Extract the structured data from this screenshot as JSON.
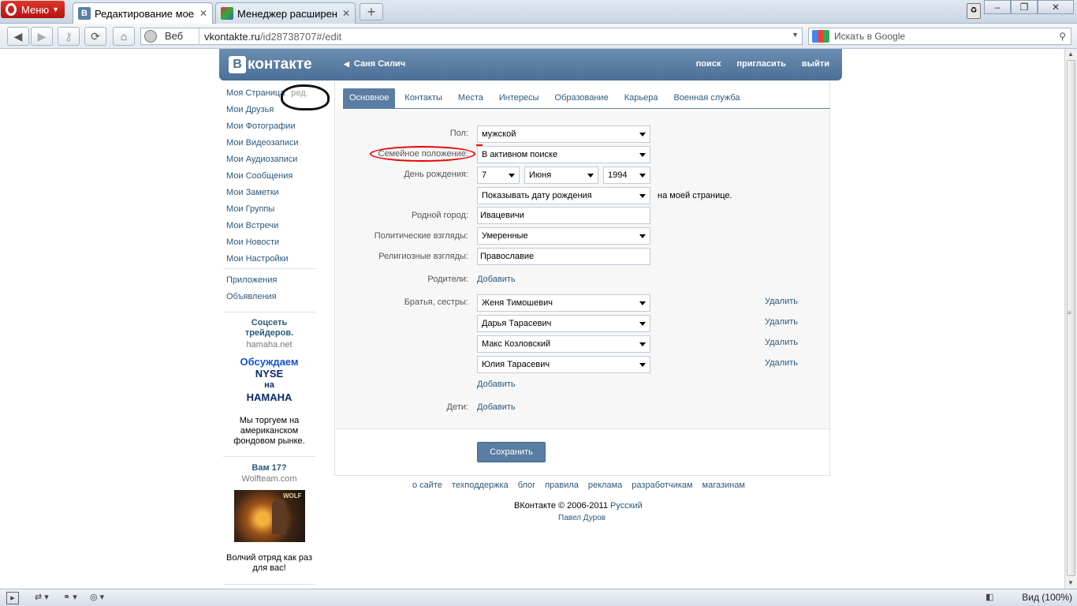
{
  "browser": {
    "menu_label": "Меню",
    "tabs": [
      {
        "title": "Редактирование моей...",
        "favicon": "В"
      },
      {
        "title": "Менеджер расширен..."
      }
    ],
    "address": {
      "web_label": "Веб",
      "url_host": "vkontakte.ru",
      "url_path": "/id28738707#/edit"
    },
    "search_placeholder": "Искать в Google",
    "zoom": "Вид (100%)"
  },
  "vk": {
    "logo": "контакте",
    "logo_letter": "В",
    "user_name": "Саня Силич",
    "top_links": [
      "поиск",
      "пригласить",
      "выйти"
    ],
    "left_menu": [
      {
        "label": "Моя Страница",
        "extra": "ред."
      },
      {
        "label": "Мои Друзья"
      },
      {
        "label": "Мои Фотографии"
      },
      {
        "label": "Мои Видеозаписи"
      },
      {
        "label": "Мои Аудиозаписи"
      },
      {
        "label": "Мои Сообщения"
      },
      {
        "label": "Мои Заметки"
      },
      {
        "label": "Мои Группы"
      },
      {
        "label": "Мои Встречи"
      },
      {
        "label": "Мои Новости"
      },
      {
        "label": "Мои Настройки"
      }
    ],
    "left_menu2": [
      "Приложения",
      "Объявления"
    ],
    "ads": {
      "ad1_title": "Соцсеть трейдеров.",
      "ad1_domain": "hamaha.net",
      "ad1_line1": "Обсуждаем",
      "ad1_line2": "NYSE",
      "ad1_line3": "на",
      "ad1_line4": "HAMAHA",
      "ad1_text": "Мы торгуем на американском фондовом рынке.",
      "ad2_title": "Вам 17?",
      "ad2_domain": "Wolfteam.com",
      "ad2_img_text": "WOLF",
      "ad2_text": "Волчий отряд как раз для вас!"
    },
    "tabs": [
      "Основное",
      "Контакты",
      "Места",
      "Интересы",
      "Образование",
      "Карьера",
      "Военная служба"
    ],
    "form": {
      "gender_label": "Пол:",
      "gender_value": "мужской",
      "status_label": "Семейное положение:",
      "status_value": "В активном поиске",
      "birthday_label": "День рождения:",
      "bday_day": "7",
      "bday_month": "Июня",
      "bday_year": "1994",
      "bday_show": "Показывать дату рождения",
      "bday_show_suffix": "на моей странице.",
      "hometown_label": "Родной город:",
      "hometown_value": "Ивацевичи",
      "political_label": "Политические взгляды:",
      "political_value": "Умеренные",
      "religion_label": "Религиозные взгляды:",
      "religion_value": "Православие",
      "parents_label": "Родители:",
      "add_label": "Добавить",
      "siblings_label": "Братья, сестры:",
      "siblings": [
        "Женя Тимошевич",
        "Дарья Тарасевич",
        "Макс Козловский",
        "Юлия Тарасевич"
      ],
      "delete_label": "Удалить",
      "children_label": "Дети:",
      "save_label": "Сохранить"
    },
    "footer_links": [
      "о сайте",
      "техподдержка",
      "блог",
      "правила",
      "реклама",
      "разработчикам",
      "магазинам"
    ],
    "copyright": "ВКонтакте © 2006-2011",
    "language": "Русский",
    "author": "Павел Дуров"
  },
  "colors": {
    "vk_blue": "#597da3",
    "link": "#2b587a",
    "annotation_red": "#e00000"
  }
}
